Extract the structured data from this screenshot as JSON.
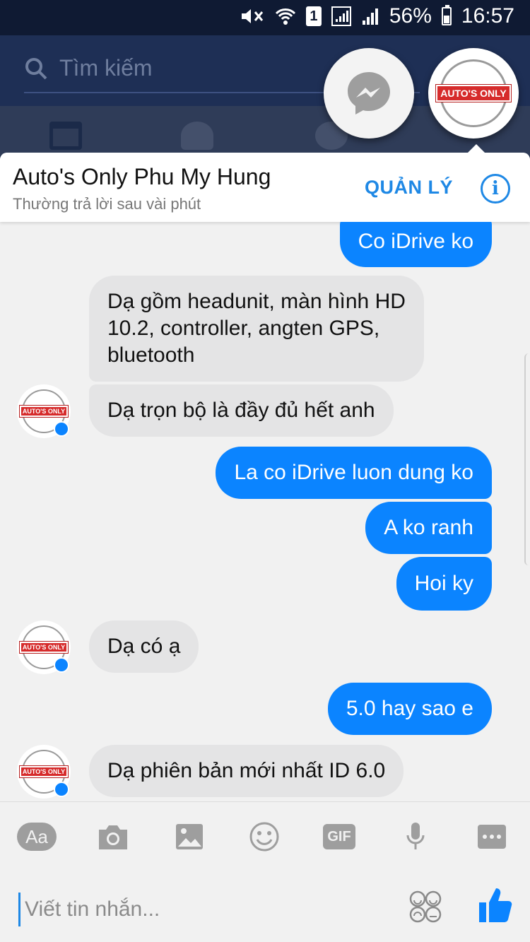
{
  "status_bar": {
    "battery": "56%",
    "time": "16:57",
    "sim": "1",
    "icons": [
      "mute-icon",
      "wifi-icon",
      "sim-icon",
      "signal-icon",
      "signal-icon",
      "battery-icon"
    ]
  },
  "background": {
    "search_placeholder": "Tìm kiếm"
  },
  "chat_heads": [
    "messenger-icon",
    "autos-only-avatar"
  ],
  "logo_text": "AUTO'S ONLY",
  "conversation": {
    "title": "Auto's Only Phu My Hung",
    "subtitle": "Thường trả lời sau vài phút",
    "manage_label": "QUẢN LÝ",
    "info_icon": "i"
  },
  "messages": [
    {
      "from": "me",
      "text": "Co iDrive ko"
    },
    {
      "from": "page",
      "lines": [
        "Dạ gồm headunit, màn hình HD",
        "10.2, controller, angten GPS,",
        "bluetooth"
      ]
    },
    {
      "from": "page",
      "text": "Dạ trọn bộ là đầy đủ hết anh"
    },
    {
      "from": "me",
      "text": "La co iDrive luon dung ko"
    },
    {
      "from": "me",
      "text": "A ko ranh"
    },
    {
      "from": "me",
      "text": "Hoi ky"
    },
    {
      "from": "page",
      "text": "Dạ có ạ"
    },
    {
      "from": "me",
      "text": "5.0 hay sao e"
    },
    {
      "from": "page",
      "text": "Dạ phiên bản mới nhất ID 6.0"
    }
  ],
  "composer": {
    "tools": [
      "text-format-icon",
      "camera-icon",
      "image-icon",
      "emoji-icon",
      "gif-icon",
      "microphone-icon",
      "more-icon"
    ],
    "aa_label": "Aa",
    "gif_label": "GIF",
    "placeholder": "Viết tin nhắn..."
  },
  "colors": {
    "outgoing_bubble": "#0b84ff",
    "incoming_bubble": "#e4e4e5",
    "accent": "#1e88e5",
    "logo_red": "#d62b2b"
  }
}
